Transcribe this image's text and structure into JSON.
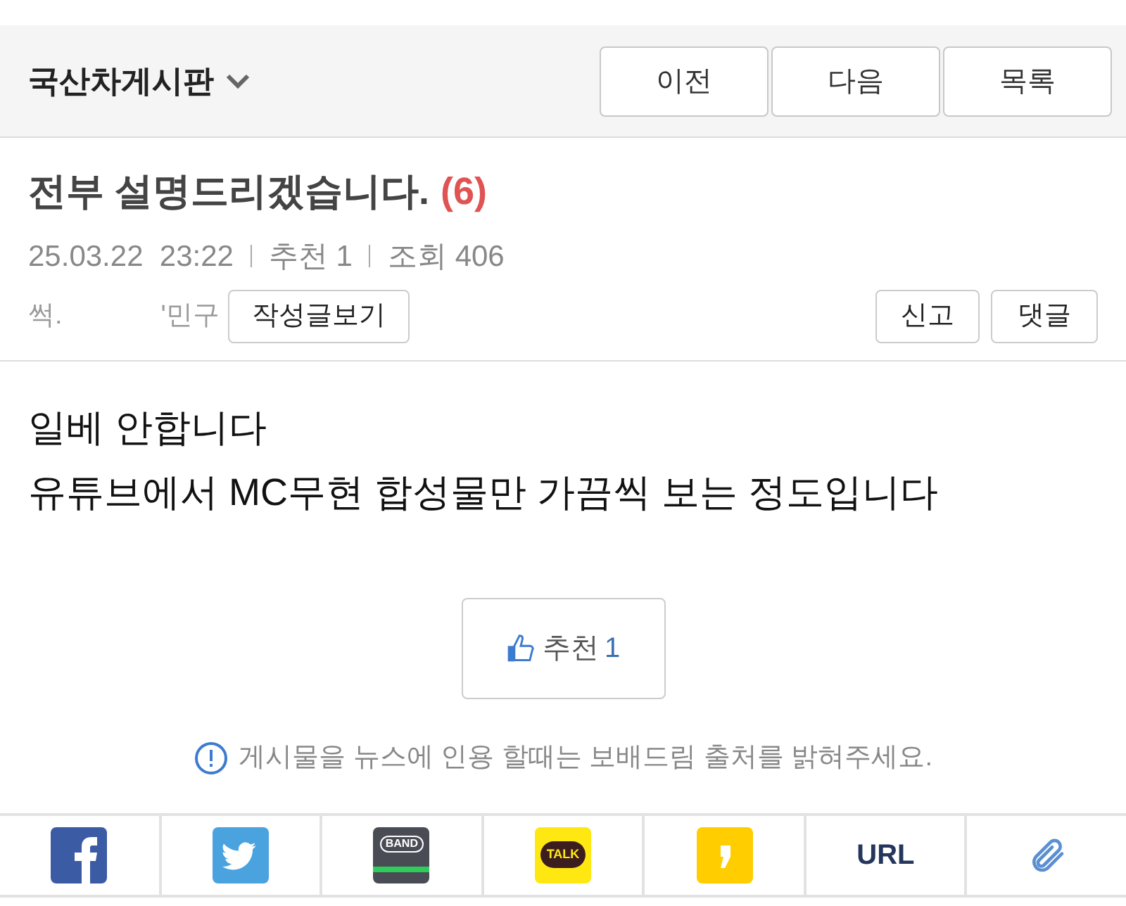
{
  "board": {
    "title": "국산차게시판",
    "nav_buttons": [
      "이전",
      "다음",
      "목록"
    ]
  },
  "post": {
    "title": "전부 설명드리겠습니다.",
    "comment_count": "(6)",
    "date": "25.03.22  23:22",
    "recommend": "추천 1",
    "views": "조회 406",
    "author_start": "썩.",
    "author_end": "'민구",
    "author_posts_button": "작성글보기",
    "report_button": "신고",
    "reply_button": "댓글",
    "body": [
      "일베 안합니다",
      "유튜브에서 MC무현 합성물만 가끔씩 보는 정도입니다"
    ],
    "like_button": {
      "label": "추천",
      "count": "1"
    },
    "notice": "게시물을 뉴스에 인용 할때는 보배드림 출처를 밝혀주세요."
  },
  "share": [
    {
      "kind": "facebook"
    },
    {
      "kind": "twitter"
    },
    {
      "kind": "band",
      "text": "BAND"
    },
    {
      "kind": "kakaotalk",
      "text": "TALK"
    },
    {
      "kind": "kakaostory"
    },
    {
      "kind": "url",
      "text": "URL"
    },
    {
      "kind": "clip"
    }
  ]
}
